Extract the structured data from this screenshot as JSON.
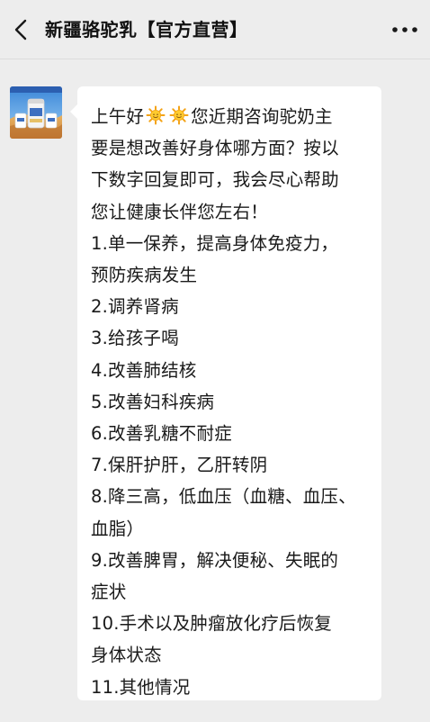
{
  "header": {
    "title": "新疆骆驼乳【官方直营】",
    "back_icon": "chevron-left-icon",
    "more_icon": "more-dots-icon"
  },
  "avatar": {
    "icon": "product-avatar-image"
  },
  "message": {
    "greeting_prefix": "上午好",
    "greeting_emoji": "sun-emoji",
    "greeting_suffix": "您近期咨询驼奶主",
    "lines": [
      "要是想改善好身体哪方面？按以",
      "下数字回复即可，我会尽心帮助",
      "您让健康长伴您左右！",
      "1.单一保养，提高身体免疫力，",
      "预防疾病发生",
      "2.调养肾病",
      "3.给孩子喝",
      "4.改善肺结核",
      "5.改善妇科疾病",
      "6.改善乳糖不耐症",
      "7.保肝护肝，乙肝转阴",
      "8.降三高，低血压（血糖、血压、",
      "血脂）",
      "9.改善脾胃，解决便秘、失眠的",
      "症状",
      "10.手术以及肿瘤放化疗后恢复",
      "身体状态",
      "11.其他情况"
    ]
  },
  "colors": {
    "background": "#ededed",
    "bubble": "#ffffff",
    "text": "#1a1a1a"
  }
}
